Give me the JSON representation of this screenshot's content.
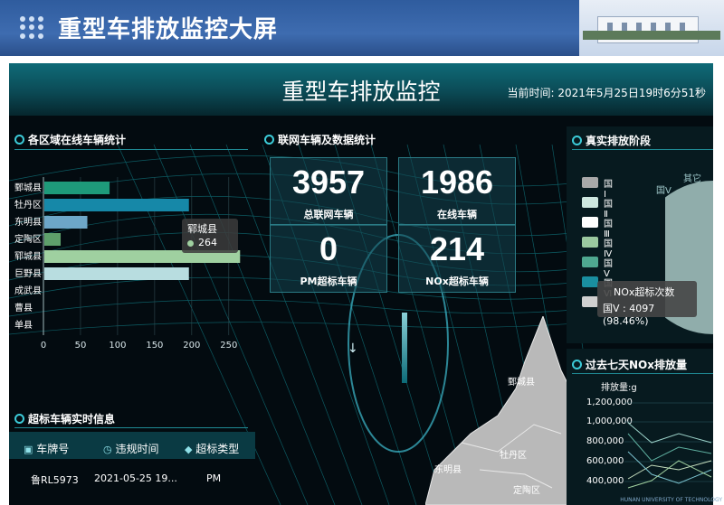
{
  "slide": {
    "title": "重型车排放监控大屏"
  },
  "dashboard": {
    "title": "重型车排放监控",
    "time_label": "当前时间: 2021年5月25日19时6分51秒"
  },
  "district_panel": {
    "title": "各区域在线车辆统计",
    "tooltip": {
      "name": "郓城县",
      "value": "264"
    }
  },
  "chart_data": {
    "type": "bar",
    "orientation": "horizontal",
    "categories": [
      "鄄城县",
      "牡丹区",
      "东明县",
      "定陶区",
      "郓城县",
      "巨野县",
      "成武县",
      "曹县",
      "单县"
    ],
    "values": [
      88,
      195,
      58,
      22,
      264,
      195,
      0,
      0,
      0
    ],
    "colors": [
      "#1e9a7a",
      "#1688a8",
      "#6da6c8",
      "#5ea06b",
      "#9fd0a0",
      "#b8dde0",
      "#888888",
      "#888888",
      "#888888"
    ],
    "xlim": [
      0,
      260
    ],
    "xticks": [
      "0",
      "50",
      "100",
      "150",
      "200",
      "250"
    ],
    "grid": true
  },
  "stats_panel": {
    "title": "联网车辆及数据统计",
    "cards": [
      {
        "value": "3957",
        "label": "总联网车辆"
      },
      {
        "value": "1986",
        "label": "在线车辆"
      },
      {
        "value": "0",
        "label": "PM超标车辆"
      },
      {
        "value": "214",
        "label": "NOx超标车辆"
      }
    ]
  },
  "stage_panel": {
    "title": "真实排放阶段",
    "legend": [
      {
        "label": "国Ⅰ",
        "color": "#a9a9a9"
      },
      {
        "label": "国Ⅱ",
        "color": "#cfe8e0"
      },
      {
        "label": "国Ⅲ",
        "color": "#ffffff"
      },
      {
        "label": "国Ⅳ",
        "color": "#9bc9a0"
      },
      {
        "label": "国Ⅴ",
        "color": "#4fa890"
      },
      {
        "label": "国Ⅵ",
        "color": "#1a8fa0"
      },
      {
        "label": "",
        "color": "#d0d0d0"
      }
    ],
    "pie_label_other": "其它",
    "pie_label_guo5": "国Ⅴ",
    "tooltip_title": "NOx超标次数",
    "tooltip_value": "国Ⅴ : 4097 (98.46%)"
  },
  "nox_panel": {
    "title": "过去七天NOx排放量",
    "unit": "排放量:g",
    "yticks": [
      "1,200,000",
      "1,000,000",
      "800,000",
      "600,000",
      "400,000"
    ]
  },
  "map": {
    "labels": [
      "鄄城县",
      "牡丹区",
      "东明县",
      "定陶区"
    ]
  },
  "vehicle_panel": {
    "title": "超标车辆实时信息",
    "headers": [
      "车牌号",
      "违规时间",
      "超标类型"
    ],
    "rows": [
      [
        "鲁RL5973",
        "2021-05-25 19...",
        "PM"
      ]
    ]
  },
  "watermark": "HUNAN UNIVERSITY OF TECHNOLOGY"
}
